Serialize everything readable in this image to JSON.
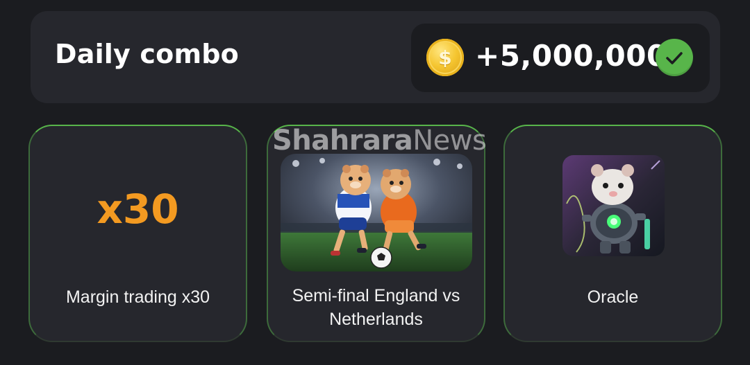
{
  "header": {
    "title": "Daily combo",
    "reward": "+5,000,000",
    "coin_symbol": "$"
  },
  "cards": [
    {
      "multiplier": "x30",
      "label": "Margin trading x30",
      "image": "none"
    },
    {
      "label": "Semi-final England vs Netherlands",
      "image": "hamsters-playing-soccer"
    },
    {
      "label": "Oracle",
      "image": "robot-hamster"
    }
  ],
  "watermark": {
    "bold": "Shahrara",
    "light": "News"
  },
  "colors": {
    "background": "#1b1c20",
    "panel": "#26272d",
    "accent_green": "#58b54a",
    "multiplier_orange": "#f39a21",
    "coin_gold": "#f5c631"
  }
}
